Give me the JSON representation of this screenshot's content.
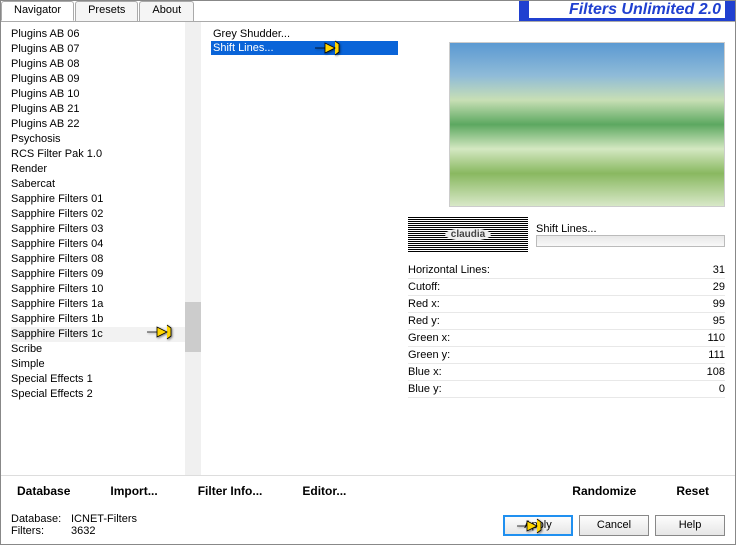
{
  "app_title": "Filters Unlimited 2.0",
  "tabs": {
    "navigator": "Navigator",
    "presets": "Presets",
    "about": "About"
  },
  "left_list": [
    "Plugins AB 06",
    "Plugins AB 07",
    "Plugins AB 08",
    "Plugins AB 09",
    "Plugins AB 10",
    "Plugins AB 21",
    "Plugins AB 22",
    "Psychosis",
    "RCS Filter Pak 1.0",
    "Render",
    "Sabercat",
    "Sapphire Filters 01",
    "Sapphire Filters 02",
    "Sapphire Filters 03",
    "Sapphire Filters 04",
    "Sapphire Filters 08",
    "Sapphire Filters 09",
    "Sapphire Filters 10",
    "Sapphire Filters 1a",
    "Sapphire Filters 1b",
    "Sapphire Filters 1c",
    "Scribe",
    "Simple",
    "Special Effects 1",
    "Special Effects 2"
  ],
  "left_selected_index": 20,
  "right_list": {
    "item0": "Grey Shudder...",
    "item1": "Shift Lines..."
  },
  "right_selected_index": 1,
  "progress_label": "Shift Lines...",
  "logo_text": "claudia",
  "params": [
    {
      "name": "Horizontal Lines:",
      "value": "31"
    },
    {
      "name": "Cutoff:",
      "value": "29"
    },
    {
      "name": "Red x:",
      "value": "99"
    },
    {
      "name": "Red y:",
      "value": "95"
    },
    {
      "name": "Green x:",
      "value": "110"
    },
    {
      "name": "Green y:",
      "value": "111"
    },
    {
      "name": "Blue x:",
      "value": "108"
    },
    {
      "name": "Blue y:",
      "value": "0"
    }
  ],
  "btns": {
    "database": "Database",
    "import": "Import...",
    "filter_info": "Filter Info...",
    "editor": "Editor...",
    "randomize": "Randomize",
    "reset": "Reset"
  },
  "status": {
    "db_label": "Database:",
    "db_value": "ICNET-Filters",
    "flt_label": "Filters:",
    "flt_value": "3632"
  },
  "footer_btns": {
    "apply": "Apply",
    "cancel": "Cancel",
    "help": "Help"
  }
}
